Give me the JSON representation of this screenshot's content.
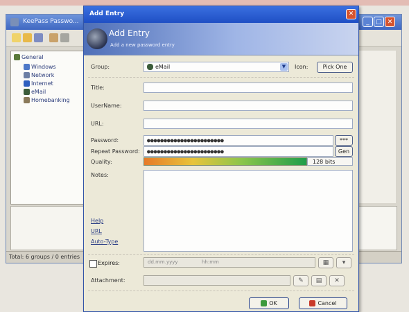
{
  "background_window": {
    "title": "KeePass Passwo...",
    "tree": [
      "General",
      "Windows",
      "Network",
      "Internet",
      "eMail",
      "Homebanking"
    ],
    "status": "Total: 6 groups / 0 entries"
  },
  "dialog": {
    "title": "Add Entry",
    "banner_title": "Add Entry",
    "banner_subtitle": "Add a new password entry",
    "labels": {
      "group": "Group:",
      "title": "Title:",
      "username": "UserName:",
      "url": "URL:",
      "password": "Password:",
      "repeat_password": "Repeat Password:",
      "quality": "Quality:",
      "notes": "Notes:",
      "icon": "Icon:",
      "expires": "Expires:",
      "attachment": "Attachment:"
    },
    "group_value": "eMail",
    "icon_button": "Pick One",
    "title_value": "",
    "username_value": "",
    "url_value": "",
    "password_value": "●●●●●●●●●●●●●●●●●●●●●●●",
    "repeat_password_value": "●●●●●●●●●●●●●●●●●●●●●●●",
    "reveal_button": "***",
    "gen_button": "Gen",
    "quality_text": "128 bits",
    "quality_fraction": 0.78,
    "links": [
      "Help",
      "URL",
      "Auto-Type"
    ],
    "expires_date": "dd.mm.yyyy",
    "expires_time": "hh:mm",
    "ok": "OK",
    "cancel": "Cancel"
  }
}
